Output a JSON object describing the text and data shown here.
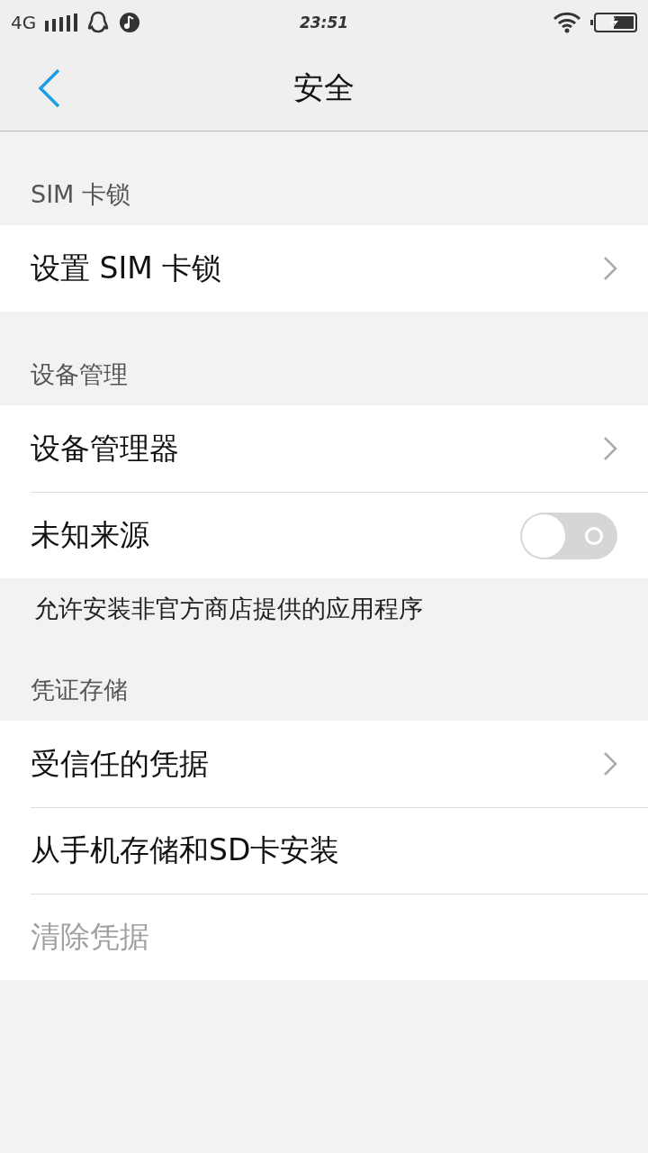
{
  "status_bar": {
    "network": "4G",
    "time": "23:51"
  },
  "header": {
    "title": "安全"
  },
  "sections": [
    {
      "title": "SIM 卡锁",
      "rows": [
        {
          "kind": "link",
          "label": "设置 SIM 卡锁",
          "disabled": false
        }
      ]
    },
    {
      "title": "设备管理",
      "rows": [
        {
          "kind": "link",
          "label": "设备管理器",
          "disabled": false
        },
        {
          "kind": "toggle",
          "label": "未知来源",
          "on": false,
          "disabled": false
        }
      ],
      "note": "允许安装非官方商店提供的应用程序"
    },
    {
      "title": "凭证存储",
      "rows": [
        {
          "kind": "link",
          "label": "受信任的凭据",
          "disabled": false
        },
        {
          "kind": "plain",
          "label": "从手机存储和SD卡安装",
          "disabled": false
        },
        {
          "kind": "plain",
          "label": "清除凭据",
          "disabled": true
        }
      ]
    }
  ]
}
